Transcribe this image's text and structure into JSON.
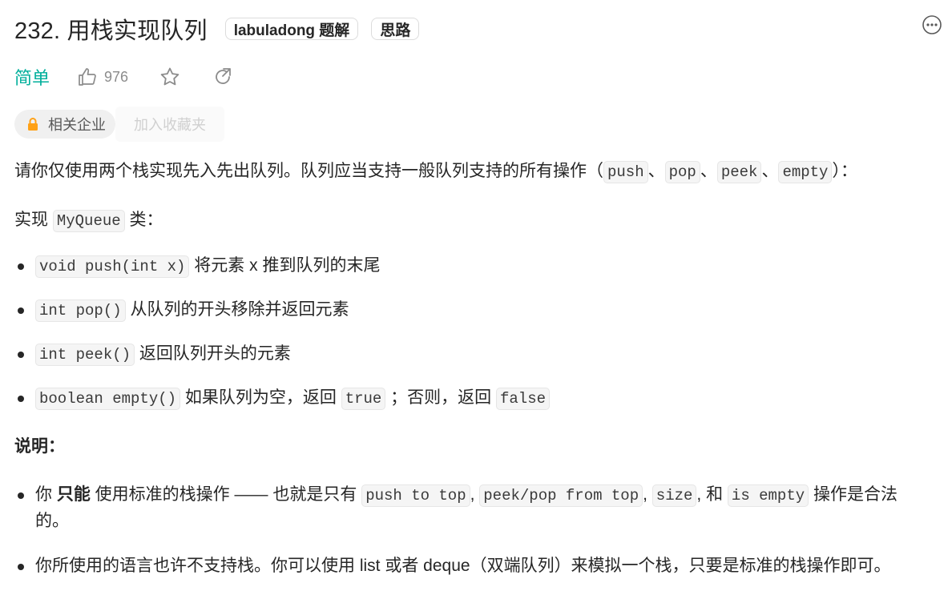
{
  "header": {
    "title": "232. 用栈实现队列",
    "tag1": "labuladong 题解",
    "tag2": "思路"
  },
  "meta": {
    "difficulty": "简单",
    "likes": "976"
  },
  "company": {
    "label": "相关企业",
    "ghost_button": "加入收藏夹"
  },
  "description": {
    "p1_text": "请你仅使用两个栈实现先入先出队列。队列应当支持一般队列支持的所有操作（",
    "p1_code1": "push",
    "p1_sep1": "、",
    "p1_code2": "pop",
    "p1_sep2": "、",
    "p1_code3": "peek",
    "p1_sep3": "、",
    "p1_code4": "empty",
    "p1_end": "）：",
    "p2_pre": "实现 ",
    "p2_code": "MyQueue",
    "p2_post": " 类：",
    "methods": [
      {
        "code": "void push(int x)",
        "text": " 将元素 x 推到队列的末尾"
      },
      {
        "code": "int pop()",
        "text": " 从队列的开头移除并返回元素"
      },
      {
        "code": "int peek()",
        "text": " 返回队列开头的元素"
      }
    ],
    "empty_code": "boolean empty()",
    "empty_text1": " 如果队列为空，返回 ",
    "empty_code2": "true",
    "empty_text2": " ；否则，返回 ",
    "empty_code3": "false",
    "note_heading": "说明：",
    "note1_pre": "你 ",
    "note1_strong": "只能",
    "note1_mid": " 使用标准的栈操作 —— 也就是只有 ",
    "note1_code1": "push to top",
    "note1_sep1": ", ",
    "note1_code2": "peek/pop from top",
    "note1_sep2": ", ",
    "note1_code3": "size",
    "note1_sep3": ", 和 ",
    "note1_code4": "is empty",
    "note1_end": " 操作是合法的。",
    "note2": "你所使用的语言也许不支持栈。你可以使用 list 或者 deque（双端队列）来模拟一个栈，只要是标准的栈操作即可。"
  }
}
